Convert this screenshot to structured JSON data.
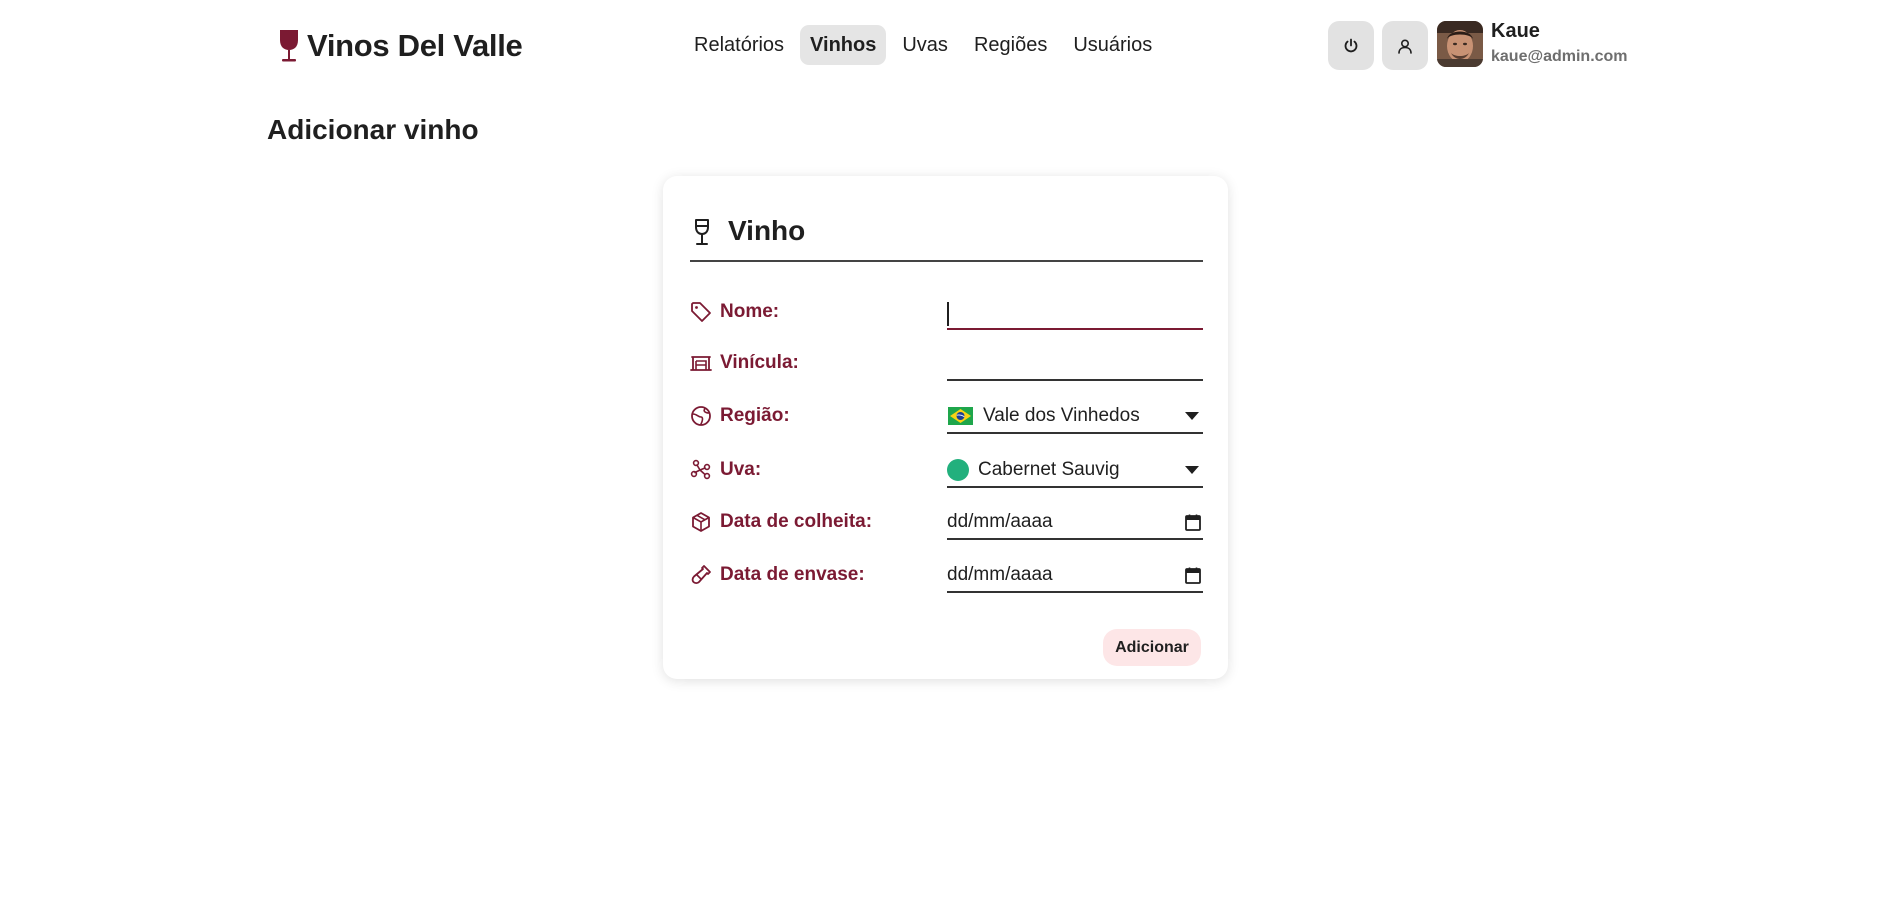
{
  "app": {
    "name": "Vinos Del Valle",
    "brand_color": "#7b1a33"
  },
  "nav": {
    "items": [
      {
        "label": "Relatórios",
        "active": false
      },
      {
        "label": "Vinhos",
        "active": true
      },
      {
        "label": "Uvas",
        "active": false
      },
      {
        "label": "Regiões",
        "active": false
      },
      {
        "label": "Usuários",
        "active": false
      }
    ]
  },
  "header": {
    "actions": [
      "power-icon",
      "user-icon"
    ],
    "user": {
      "name": "Kaue",
      "email": "kaue@admin.com"
    }
  },
  "page": {
    "title": "Adicionar vinho"
  },
  "form": {
    "title": "Vinho",
    "fields": {
      "nome": {
        "label": "Nome:",
        "value": "",
        "icon": "tag-icon",
        "focused": true
      },
      "vinicula": {
        "label": "Vinícula:",
        "value": "",
        "icon": "winery-icon"
      },
      "regiao": {
        "label": "Região:",
        "value": "Vale dos Vinhedos",
        "icon": "globe-icon",
        "flag": "brazil-flag-icon"
      },
      "uva": {
        "label": "Uva:",
        "value": "Cabernet Sauvig",
        "icon": "grape-cluster-icon",
        "dot_color": "#22b07d"
      },
      "data_colheita": {
        "label": "Data de colheita:",
        "value": "dd/mm/aaaa",
        "icon": "harvest-icon"
      },
      "data_envase": {
        "label": "Data de envase:",
        "value": "dd/mm/aaaa",
        "icon": "bottle-icon"
      }
    },
    "submit_label": "Adicionar"
  }
}
